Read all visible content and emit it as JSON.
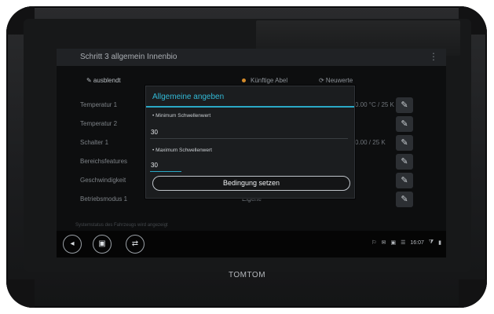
{
  "window": {
    "title": "Schritt 3 allgemein Innenbio",
    "menu_icon": "more-vertical-icon"
  },
  "toolbar": {
    "left_label": "✎ ausblendt",
    "middle_label": "Künftige Abel",
    "right_label": "⟳ Neuwerte"
  },
  "rows": [
    {
      "label": "Temperatur 1",
      "value": "0.00 °C / 25 K",
      "edit_icon": "pencil-icon"
    },
    {
      "label": "Temperatur 2",
      "value": "",
      "edit_icon": "pencil-icon"
    },
    {
      "label": "Schalter 1",
      "value": "0.00 / 25 K",
      "edit_icon": "pencil-icon"
    },
    {
      "label": "Bereichsfeatures",
      "value": "",
      "edit_icon": "pencil-icon"
    },
    {
      "label": "Geschwindigkeit",
      "value": "",
      "edit_icon": "pencil-icon"
    },
    {
      "label": "Betriebsmodus 1",
      "value": "Eigene",
      "edit_icon": "pencil-icon"
    }
  ],
  "bottom_hint": "Systemstatus des Fahrzeugs wird angezeigt",
  "dialog": {
    "title": "Allgemeine angeben",
    "field1_label": "• Minimum Schwellenwert",
    "field1_value": "30",
    "field2_label": "• Maximum Schwellenwert",
    "field2_value": "30",
    "confirm_label": "Bedingung setzen"
  },
  "nav": {
    "back_icon": "back-icon",
    "home_icon": "home-icon",
    "recent_icon": "recent-apps-icon",
    "back_glyph": "◂",
    "home_glyph": "▣",
    "recent_glyph": "⇄"
  },
  "status": {
    "items": [
      "⚐",
      "✉",
      "▣",
      "☰"
    ],
    "time": "16:07",
    "wifi": "⧩",
    "battery": "▮"
  },
  "brand": "TOMTOM",
  "colors": {
    "accent": "#2aa9c6",
    "title_accent": "#32b9d6",
    "device_body": "#1c1d1f",
    "screen_bg": "#0d0e0f"
  }
}
